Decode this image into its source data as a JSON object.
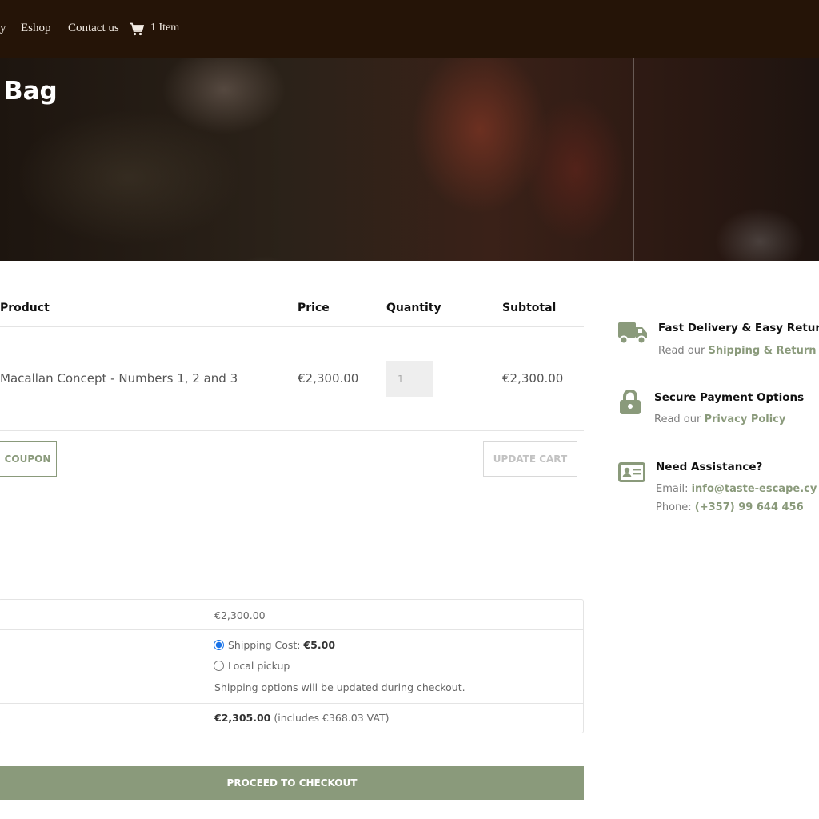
{
  "nav": {
    "partial_item": "y",
    "eshop": "Eshop",
    "contact": "Contact us",
    "cart_count": "1 Item"
  },
  "hero": {
    "title": "Bag"
  },
  "cart": {
    "headers": {
      "product": "Product",
      "price": "Price",
      "quantity": "Quantity",
      "subtotal": "Subtotal"
    },
    "rows": [
      {
        "product": "Macallan Concept - Numbers 1, 2 and 3",
        "price": "€2,300.00",
        "quantity": "1",
        "subtotal": "€2,300.00"
      }
    ],
    "coupon_button": "COUPON",
    "update_button": "UPDATE CART"
  },
  "info": {
    "delivery": {
      "title": "Fast Delivery & Easy Returns",
      "text_prefix": "Read our ",
      "link": "Shipping & Return P"
    },
    "payment": {
      "title": "Secure Payment Options",
      "text_prefix": "Read our ",
      "link": "Privacy Policy"
    },
    "assistance": {
      "title": "Need Assistance?",
      "email_prefix": "Email: ",
      "email": "info@taste-escape.cy",
      "phone_prefix": "Phone: ",
      "phone": "(+357) 99 644 456"
    }
  },
  "totals": {
    "subtotal": "€2,300.00",
    "shipping_option_label": "Shipping Cost: ",
    "shipping_option_value": "€5.00",
    "pickup_label": "Local pickup",
    "shipping_note": "Shipping options will be updated during checkout.",
    "total_value": "€2,305.00",
    "total_tax": " (includes €368.03 VAT)"
  },
  "checkout_button": "PROCEED TO CHECKOUT",
  "colors": {
    "nav_bg": "#251407",
    "accent": "#8a9a7b"
  },
  "icons": {
    "cart": "cart-icon",
    "truck": "truck-icon",
    "lock": "lock-icon",
    "id_card": "id-card-icon"
  }
}
